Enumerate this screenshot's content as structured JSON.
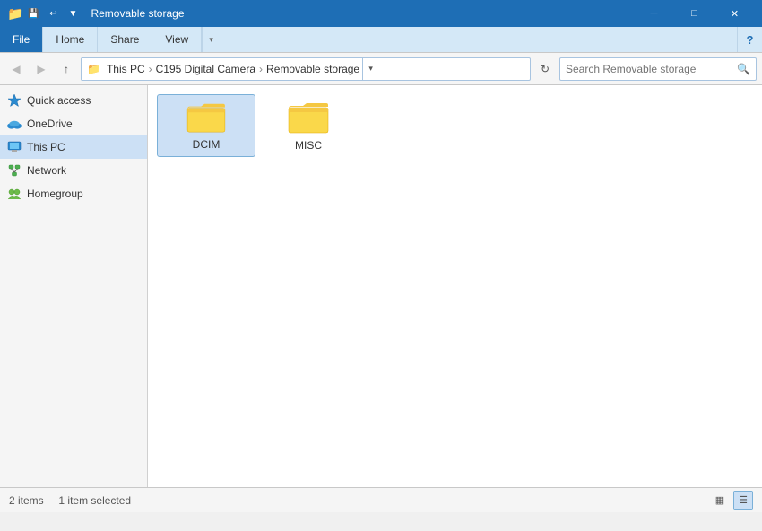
{
  "window": {
    "title": "Removable storage",
    "icon": "📁"
  },
  "titlebar": {
    "controls": {
      "minimize": "─",
      "maximize": "□",
      "close": "✕"
    }
  },
  "qat": {
    "buttons": [
      "⬇",
      "▼"
    ]
  },
  "ribbon": {
    "tabs": [
      {
        "label": "File",
        "active": true
      },
      {
        "label": "Home",
        "active": false
      },
      {
        "label": "Share",
        "active": false
      },
      {
        "label": "View",
        "active": false
      }
    ]
  },
  "addressbar": {
    "back_label": "◀",
    "forward_label": "▶",
    "up_label": "↑",
    "path_parts": [
      {
        "label": "This PC"
      },
      {
        "label": "C195 Digital Camera"
      },
      {
        "label": "Removable storage"
      }
    ],
    "refresh": "↻",
    "search_placeholder": "Search Removable storage"
  },
  "sidebar": {
    "items": [
      {
        "label": "Quick access",
        "icon": "⭐",
        "color": "#2b8acf"
      },
      {
        "label": "OneDrive",
        "icon": "☁",
        "color": "#2b8acf"
      },
      {
        "label": "This PC",
        "icon": "🖥",
        "color": "#2b8acf",
        "active": true
      },
      {
        "label": "Network",
        "icon": "🔗",
        "color": "#4caf50"
      },
      {
        "label": "Homegroup",
        "icon": "👥",
        "color": "#6dbb4a"
      }
    ]
  },
  "content": {
    "folders": [
      {
        "name": "DCIM",
        "selected": true
      },
      {
        "name": "MISC",
        "selected": false
      }
    ]
  },
  "statusbar": {
    "items_count": "2 items",
    "selection": "1 item selected",
    "view_grid": "▦",
    "view_list": "☰"
  }
}
